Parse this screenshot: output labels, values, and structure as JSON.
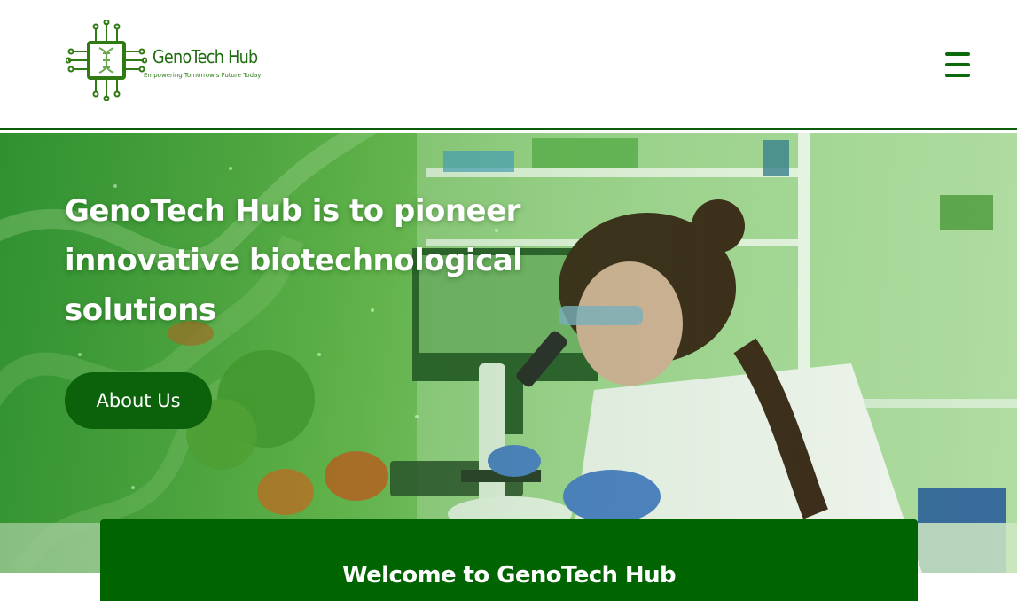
{
  "header": {
    "logo": {
      "name": "GenoTech Hub",
      "tagline": "Empowering Tomorrow's Future Today",
      "icon": "dna-chip-logo-icon"
    },
    "menu_icon": "hamburger-menu-icon"
  },
  "hero": {
    "heading": "GenoTech Hub is to pioneer innovative biotechnological solutions",
    "cta_label": "About Us",
    "image": "scientist-with-microscope-lab-photo"
  },
  "welcome": {
    "title": "Welcome to GenoTech Hub"
  },
  "colors": {
    "brand_green": "#0b620b",
    "panel_green": "#006400",
    "header_border": "#0b5d0b",
    "text_on_dark": "#ffffff"
  }
}
